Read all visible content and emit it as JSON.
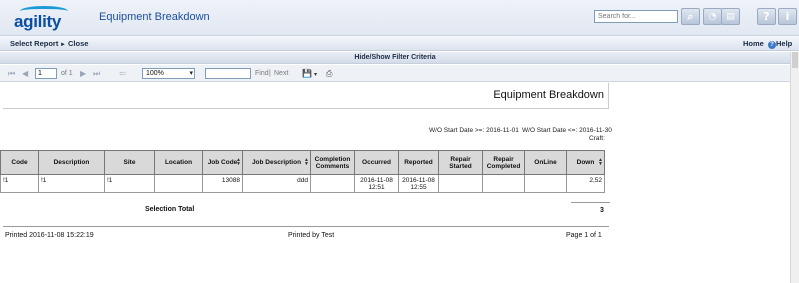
{
  "header": {
    "logo_text": "agility",
    "title": "Equipment Breakdown",
    "search_placeholder": "Search for...",
    "icons": [
      "search-icon",
      "rss-icon",
      "print-icon",
      "help-icon",
      "info-icon"
    ]
  },
  "nav": {
    "select_report": "Select Report",
    "close": "Close",
    "home": "Home",
    "help": "Help"
  },
  "filter_toggle": "Hide/Show Filter Criteria",
  "toolbar": {
    "page_value": "1",
    "page_of": "of 1",
    "zoom": "100%",
    "find_value": "",
    "find_label": "Find",
    "separator": "|",
    "next_label": "Next"
  },
  "report": {
    "title": "Equipment Breakdown",
    "criteria_start": "W/O Start Date >=: 2016-11-01",
    "criteria_end": "W/O Start Date <=: 2016-11-30",
    "criteria_craft": "Craft:",
    "columns": [
      {
        "label": "Code",
        "sortable": false
      },
      {
        "label": "Description",
        "sortable": false
      },
      {
        "label": "Site",
        "sortable": false
      },
      {
        "label": "Location",
        "sortable": false
      },
      {
        "label": "Job Code",
        "sortable": true
      },
      {
        "label": "Job Description",
        "sortable": true
      },
      {
        "label": "Completion Comments",
        "sortable": false
      },
      {
        "label": "Occurred",
        "sortable": false
      },
      {
        "label": "Reported",
        "sortable": false
      },
      {
        "label": "Repair Started",
        "sortable": false
      },
      {
        "label": "Repair Completed",
        "sortable": false
      },
      {
        "label": "OnLine",
        "sortable": false
      },
      {
        "label": "Down",
        "sortable": true
      }
    ],
    "rows": [
      [
        "!1",
        "!1",
        "!1",
        "",
        "13088",
        "ddd",
        "",
        "2016-11-08 12:51",
        "2016-11-08 12:55",
        "",
        "",
        "",
        "2,52"
      ]
    ],
    "selection_total_label": "Selection Total",
    "selection_total_value": "3",
    "footer_printed": "Printed 2016-11-08 15:22:19",
    "footer_by": "Printed by Test",
    "footer_page": "Page 1 of 1"
  }
}
